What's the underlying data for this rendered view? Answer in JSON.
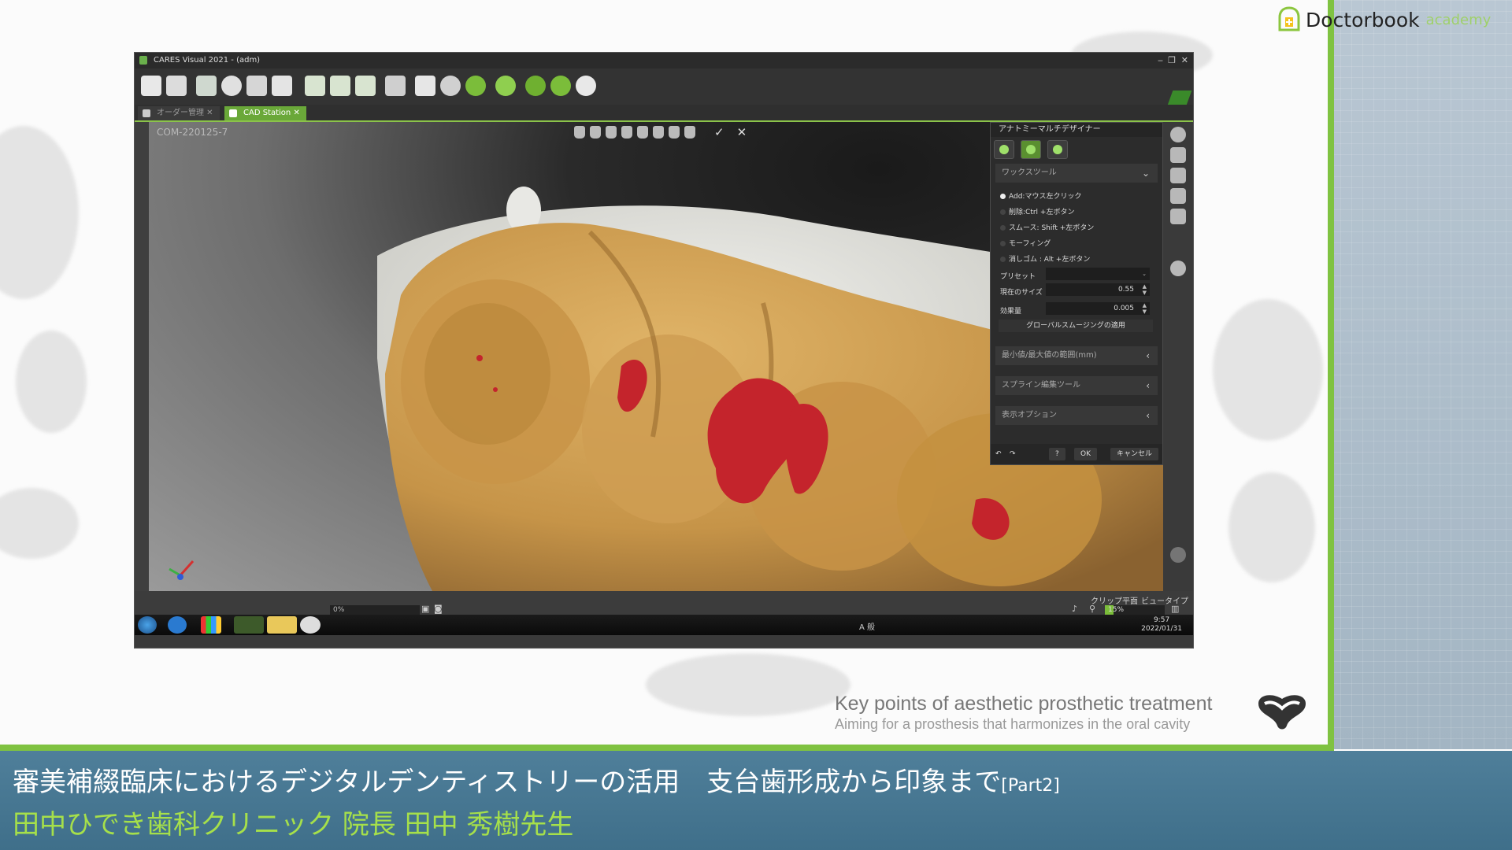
{
  "brand": {
    "name": "Doctorbook",
    "sub": "academy"
  },
  "window": {
    "title": "CARES Visual 2021 - (adm)",
    "controls": [
      "‒",
      "❐",
      "✕"
    ]
  },
  "tabs": [
    {
      "label": "オーダー管理",
      "active": false
    },
    {
      "label": "CAD Station",
      "active": true
    }
  ],
  "viewport": {
    "model_id": "COM-220125-7",
    "confirm": "✓",
    "cancel": "✕"
  },
  "panel": {
    "title": "アナトミーマルチデザイナー",
    "wax_tool": "ワックスツール",
    "options": [
      {
        "label": "Add:マウス左クリック",
        "selected": true
      },
      {
        "label": "削除:Ctrl +左ボタン",
        "selected": false
      },
      {
        "label": "スムース: Shift +左ボタン",
        "selected": false
      },
      {
        "label": "モーフィング",
        "selected": false
      },
      {
        "label": "消しゴム : Alt +左ボタン",
        "selected": false
      }
    ],
    "preset_label": "プリセット",
    "preset_value": "",
    "size_label": "現在のサイズ",
    "size_value": "0.55",
    "effect_label": "効果量",
    "effect_value": "0.005",
    "apply_global_smoothing": "グローバルスムージングの適用",
    "sections": [
      "最小値/最大値の範囲(mm)",
      "スプライン編集ツール",
      "表示オプション"
    ],
    "ok": "OK",
    "cancel": "キャンセル",
    "help": "?"
  },
  "status": {
    "clip_plane": "クリップ平面",
    "view_type": "ビュータイプ",
    "progress": "0%",
    "zoom_label": "15%",
    "zoom_fraction": 0.15
  },
  "taskbar": {
    "time": "9:57",
    "date": "2022/01/31",
    "tray": "A 般"
  },
  "caption": {
    "line1": "Key points of aesthetic prosthetic treatment",
    "line2": "Aiming for a prosthesis that harmonizes in the oral cavity"
  },
  "lower_third": {
    "title": "審美補綴臨床におけるデジタルデンティストリーの活用　支台歯形成から印象まで",
    "part": "[Part2]",
    "presenter": "田中ひでき歯科クリニック 院長 田中 秀樹先生"
  },
  "colors": {
    "accent": "#7fc241",
    "model": "#c9994a",
    "highlight": "#c4242c",
    "brand_bar": "#4a7a95"
  }
}
